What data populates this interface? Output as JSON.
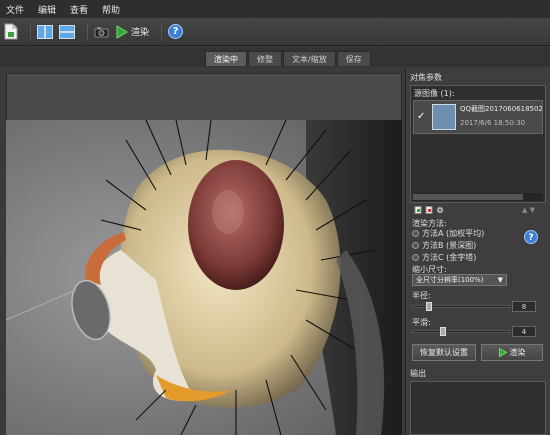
{
  "menu": [
    "文件",
    "编辑",
    "查看",
    "帮助"
  ],
  "toolbar": {
    "render_label": "渲染"
  },
  "tabs": [
    "渲染中",
    "修整",
    "文本/缩放",
    "保存"
  ],
  "panel": {
    "title": "对焦参数",
    "source_label": "源图像 (1):",
    "source_item": {
      "name": "QQ截图20170606185025",
      "date": "2017/6/6 18:50:30"
    },
    "render_method_label": "渲染方法:",
    "methods": [
      "方法A (加权平均)",
      "方法B (景深图)",
      "方法C (金字塔)"
    ],
    "reduce_label": "缩小尺寸:",
    "reduce_value": "全尺寸分辨率(100%)",
    "radius_label": "半径:",
    "radius_value": "8",
    "smooth_label": "平滑:",
    "smooth_value": "4",
    "reset_button": "恢复默认设置",
    "render_button": "渲染",
    "output_label": "输出"
  },
  "colors": {
    "accent": "#3d7ed6",
    "play_green": "#2fa82f"
  }
}
